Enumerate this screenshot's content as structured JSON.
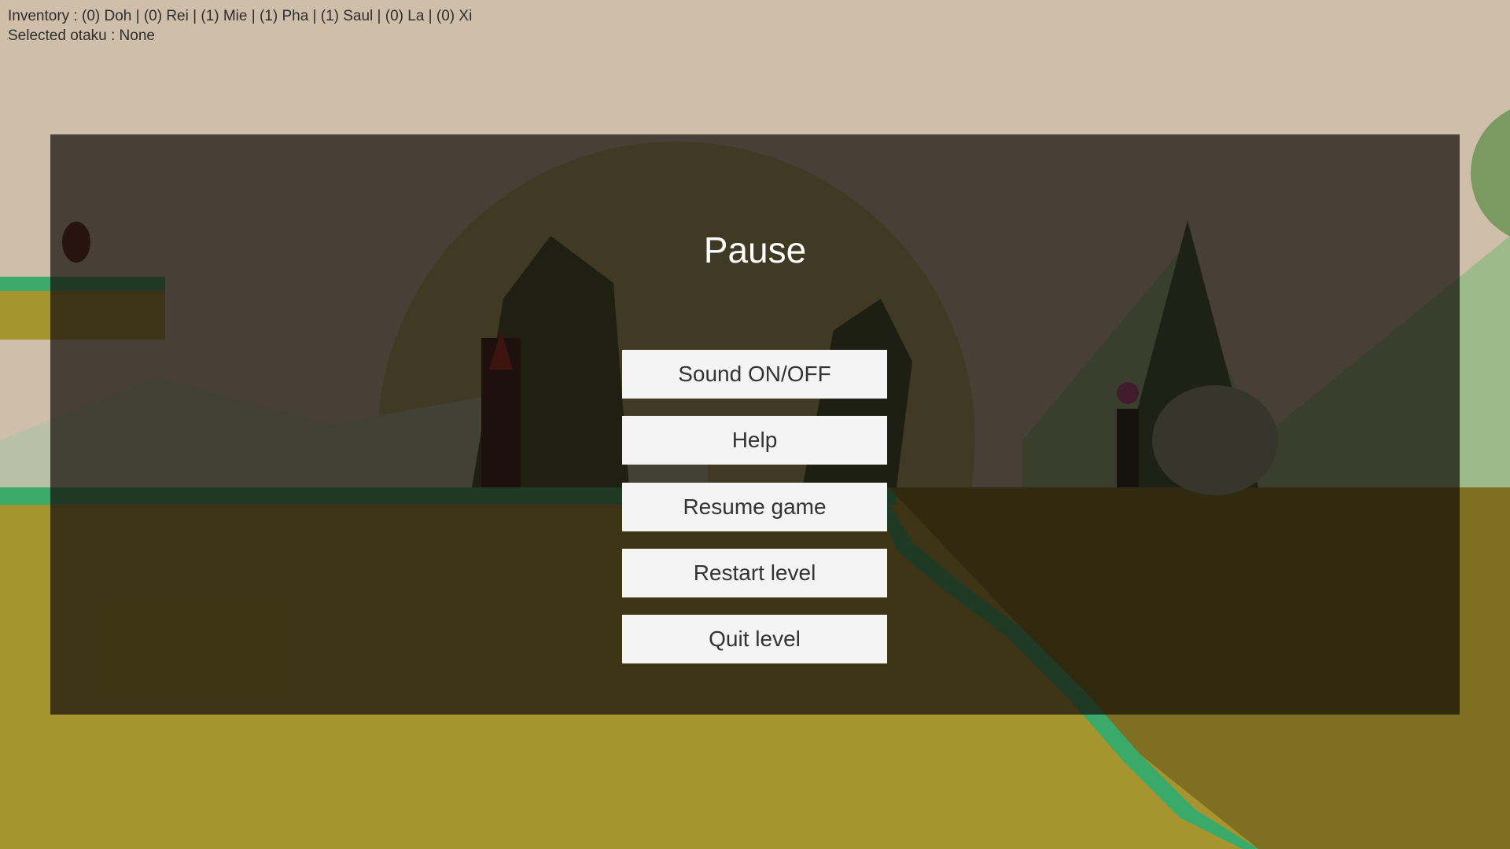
{
  "hud": {
    "inventory": "Inventory : (0) Doh | (0) Rei | (1) Mie | (1) Pha | (1) Saul | (0) La | (0) Xi",
    "selected_otaku": "Selected otaku : None"
  },
  "pause_menu": {
    "title": "Pause",
    "buttons": [
      {
        "label": "Sound ON/OFF"
      },
      {
        "label": "Help"
      },
      {
        "label": "Resume game"
      },
      {
        "label": "Restart level"
      },
      {
        "label": "Quit level"
      }
    ]
  },
  "colors": {
    "sky": "#cfbea9",
    "ground": "#a6942f",
    "grass": "#3aaa6a",
    "overlay": "rgba(20,15,10,0.72)",
    "button_bg": "#f4f4f4",
    "button_text": "#333333"
  }
}
